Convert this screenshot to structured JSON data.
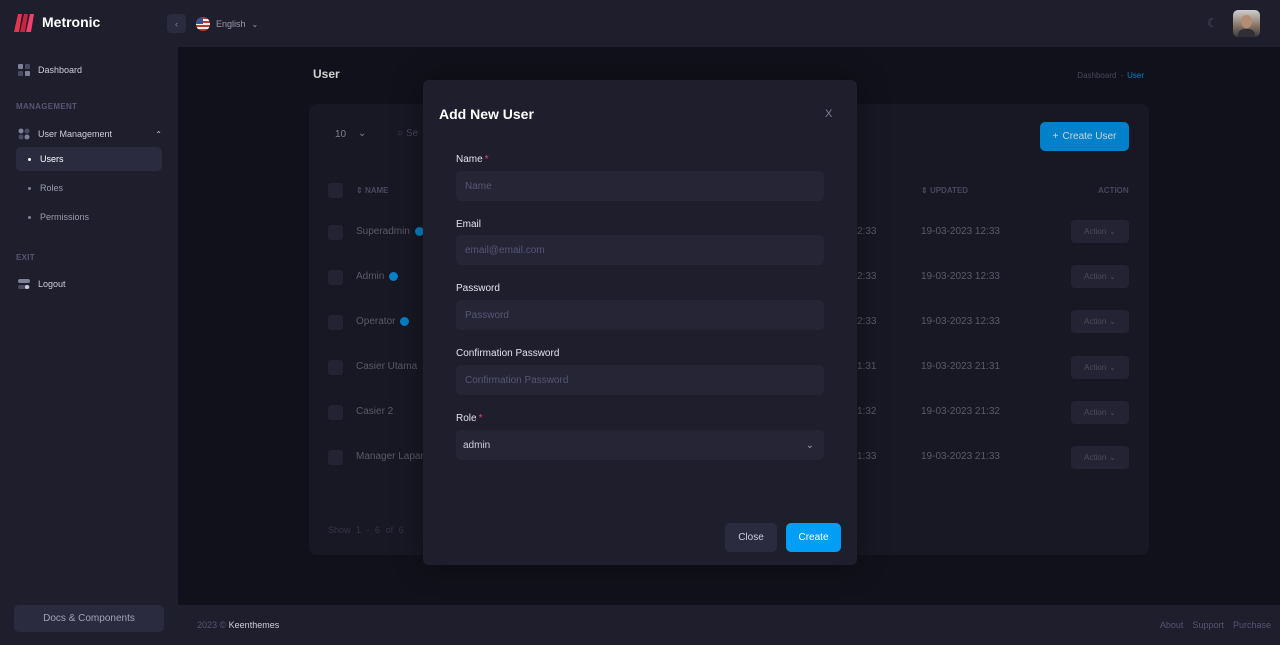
{
  "app": {
    "brand": "Metronic"
  },
  "header": {
    "language": "English"
  },
  "sidebar": {
    "dashboard": "Dashboard",
    "section_management": "MANAGEMENT",
    "user_management": "User Management",
    "items": [
      {
        "label": "Users",
        "active": true
      },
      {
        "label": "Roles",
        "active": false
      },
      {
        "label": "Permissions",
        "active": false
      }
    ],
    "section_exit": "EXIT",
    "logout": "Logout",
    "docs_button": "Docs & Components"
  },
  "page": {
    "title": "User",
    "breadcrumb": {
      "home": "Dashboard",
      "separator": "-",
      "current": "User"
    }
  },
  "table": {
    "per_page": "10",
    "search_fragment": "Se",
    "create_button": "Create User",
    "headers": {
      "name": "NAME",
      "updated": "UPDATED",
      "action": "ACTION"
    },
    "rows": [
      {
        "name": "Superadmin",
        "verified": true,
        "created_frag": "2:33",
        "updated": "19-03-2023 12:33",
        "action": "Action"
      },
      {
        "name": "Admin",
        "verified": true,
        "created_frag": "2:33",
        "updated": "19-03-2023 12:33",
        "action": "Action"
      },
      {
        "name": "Operator",
        "verified": true,
        "created_frag": "2:33",
        "updated": "19-03-2023 12:33",
        "action": "Action"
      },
      {
        "name": "Casier Utama",
        "verified": false,
        "created_frag": "1:31",
        "updated": "19-03-2023 21:31",
        "action": "Action"
      },
      {
        "name": "Casier 2",
        "verified": false,
        "created_frag": "1:32",
        "updated": "19-03-2023 21:32",
        "action": "Action"
      },
      {
        "name": "Manager Lapang",
        "verified": false,
        "created_frag": "1:33",
        "updated": "19-03-2023 21:33",
        "action": "Action"
      }
    ],
    "showing": {
      "show": "Show",
      "range": "1 - 6",
      "of": "of",
      "total": "6"
    }
  },
  "modal": {
    "title": "Add New User",
    "close_icon": "X",
    "fields": {
      "name": {
        "label": "Name",
        "placeholder": "Name",
        "required": true
      },
      "email": {
        "label": "Email",
        "placeholder": "email@email.com"
      },
      "password": {
        "label": "Password",
        "placeholder": "Password"
      },
      "confirm": {
        "label": "Confirmation Password",
        "placeholder": "Confirmation Password"
      },
      "role": {
        "label": "Role",
        "value": "admin",
        "required": true
      }
    },
    "close_button": "Close",
    "create_button": "Create"
  },
  "footer": {
    "year": "2023 ©",
    "brand": "Keenthemes",
    "links": [
      "About",
      "Support",
      "Purchase"
    ]
  },
  "colors": {
    "primary": "#009ef7",
    "bg": "#151521",
    "panel": "#1e1e2d",
    "required": "#f1416c"
  }
}
